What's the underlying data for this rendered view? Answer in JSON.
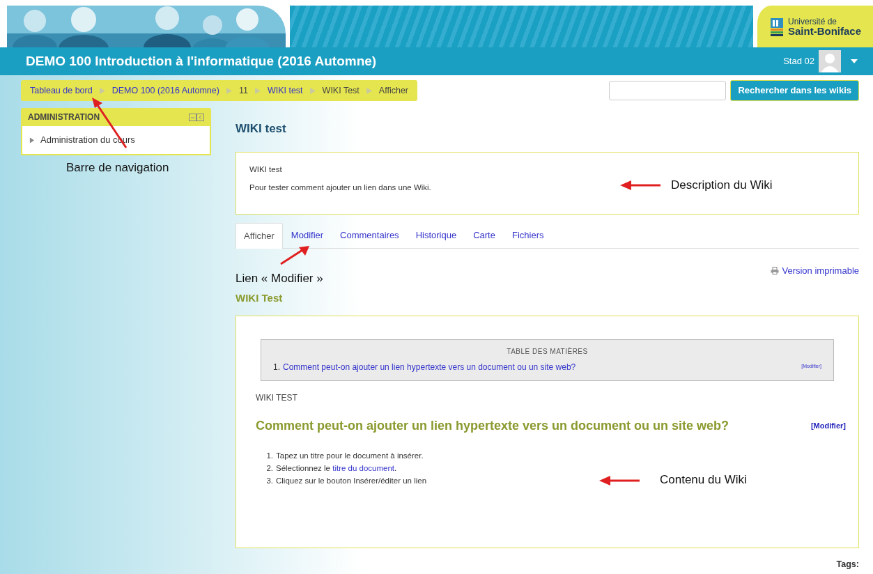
{
  "banner": {
    "logo": {
      "line1": "Université de",
      "line2": "Saint-Boniface"
    }
  },
  "header": {
    "course_title": "DEMO 100 Introduction à l'informatique (2016 Automne)",
    "user_name": "Stad 02"
  },
  "breadcrumb": [
    {
      "label": "Tableau de bord",
      "link": true
    },
    {
      "label": "DEMO 100 (2016 Automne)",
      "link": true
    },
    {
      "label": "11",
      "link": false
    },
    {
      "label": "WIKI test",
      "link": true
    },
    {
      "label": "WIKI Test",
      "link": false
    },
    {
      "label": "Afficher",
      "link": false
    }
  ],
  "search": {
    "button": "Rechercher dans les wikis"
  },
  "admin_block": {
    "title": "ADMINISTRATION",
    "items": [
      {
        "label": "Administration du cours",
        "expanded": false
      }
    ]
  },
  "wiki": {
    "title": "WIKI test",
    "description": {
      "name": "WIKI test",
      "text": "Pour tester comment ajouter un lien dans une Wiki."
    },
    "tabs": [
      {
        "label": "Afficher",
        "selected": true
      },
      {
        "label": "Modifier",
        "selected": false
      },
      {
        "label": "Commentaires",
        "selected": false
      },
      {
        "label": "Historique",
        "selected": false
      },
      {
        "label": "Carte",
        "selected": false
      },
      {
        "label": "Fichiers",
        "selected": false
      }
    ],
    "print_link": "Version imprimable",
    "page_title": "WIKI Test",
    "toc": {
      "title": "TABLE DES MATIÈRES",
      "items": [
        {
          "number": "1.",
          "label": "Comment peut-on ajouter un lien hypertexte vers un document ou un site web?",
          "edit": "[Modifier]"
        }
      ]
    },
    "content_heading": "WIKI TEST",
    "section": {
      "title": "Comment peut-on ajouter un lien hypertexte vers un document ou un site web?",
      "edit": "[Modifier]"
    },
    "steps": [
      {
        "number": "1.",
        "text": "Tapez un titre pour le document à insérer."
      },
      {
        "number": "2.",
        "text": "Sélectionnez le ",
        "link": "titre du document",
        "after": "."
      },
      {
        "number": "3.",
        "text": "Cliquez sur le bouton Insérer/éditer un lien"
      }
    ],
    "tags_label": "Tags:"
  },
  "annotations": [
    {
      "label": "Barre de navigation"
    },
    {
      "label": "Description du Wiki"
    },
    {
      "label": "Lien « Modifier »"
    },
    {
      "label": "Contenu du Wiki"
    }
  ]
}
